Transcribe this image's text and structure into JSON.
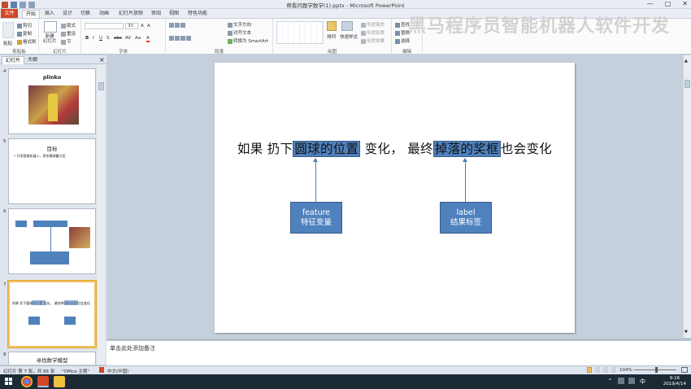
{
  "window": {
    "title": "帮看问题学数学(1).pptx - Microsoft PowerPoint",
    "controls": [
      "—",
      "□",
      "✕"
    ]
  },
  "tabs": [
    "文件",
    "开始",
    "插入",
    "设计",
    "切换",
    "动画",
    "幻灯片放映",
    "审阅",
    "视图",
    "特色功能"
  ],
  "ribbon": {
    "groups": [
      "剪贴板",
      "幻灯片",
      "字体",
      "段落",
      "绘图",
      "编辑"
    ],
    "clipboard": {
      "paste": "粘贴",
      "cut": "剪切",
      "copy": "复制",
      "format_painter": "格式刷"
    },
    "slides": {
      "new_slide": "新建\n幻灯片",
      "layout": "版式",
      "reset": "重设",
      "section": "节"
    },
    "font": {
      "size": "30",
      "bold": "B",
      "italic": "I",
      "underline": "U",
      "shadow": "S",
      "strike": "abc",
      "spacing": "AV",
      "case": "Aa",
      "color": "A",
      "grow": "A",
      "shrink": "A"
    },
    "paragraph": {
      "text_direction": "文字方向",
      "align_text": "对齐文本",
      "smartart": "转换为 SmartArt"
    },
    "drawing": {
      "arrange": "排列",
      "quick_styles": "快速样式",
      "fill": "形状填充",
      "outline": "形状轮廓",
      "effects": "形状效果"
    },
    "editing": {
      "find": "查找",
      "replace": "替换",
      "select": "选择"
    }
  },
  "watermark": "黑马程序员智能机器人软件开发",
  "panel": {
    "tab_slides": "幻灯片",
    "tab_outline": "大纲",
    "close": "×"
  },
  "thumbnails": [
    {
      "num": "4",
      "title": "plinko"
    },
    {
      "num": "5",
      "title": "目标",
      "bullet": "• 开发智能机器人，抓所需球赢大奖"
    },
    {
      "num": "6"
    },
    {
      "num": "7",
      "sentence": "如果 扔下圆球的位置 变化， 最终掉落的奖框也会变化"
    },
    {
      "num": "8",
      "title": "寻找数学模型"
    }
  ],
  "slide": {
    "sentence_pre": "如果 扔下",
    "highlight1": "圆球的位置",
    "sentence_mid": " 变化， 最终",
    "highlight2": "掉落的奖框",
    "sentence_post": "也会变化",
    "feature_line1": "feature",
    "feature_line2": "特征变量",
    "label_line1": "label",
    "label_line2": "结果标签"
  },
  "notes": {
    "placeholder": "单击此处添加备注"
  },
  "statusbar": {
    "slide_info": "幻灯片 第 7 张，共 86 张",
    "theme": "\"Office 主题\"",
    "language": "中文(中国)",
    "zoom": "104%"
  },
  "taskbar": {
    "time": "9:16",
    "date": "2019/4/14",
    "ime": "中"
  },
  "colors": {
    "accent": "#4f81bd",
    "accent_border": "#385d8a",
    "file_tab": "#d24726",
    "selected_thumb": "#f0c060"
  }
}
